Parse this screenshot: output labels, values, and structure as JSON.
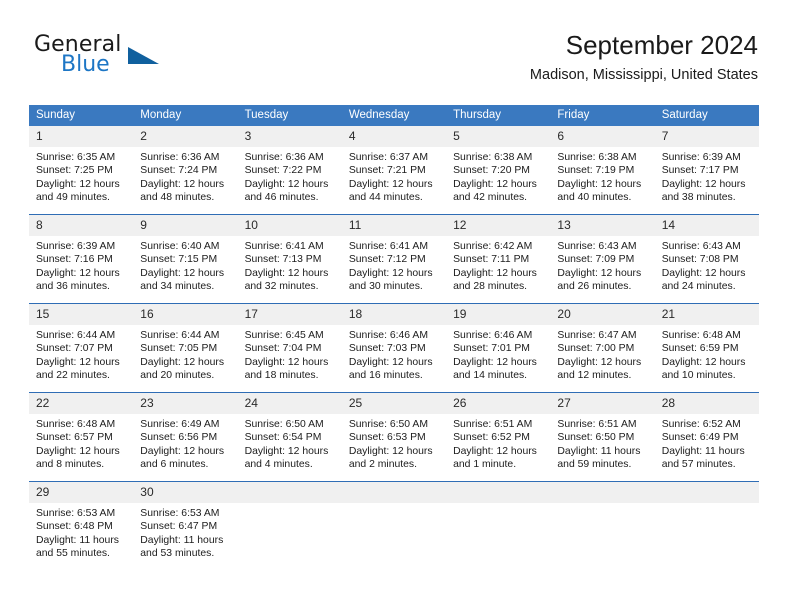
{
  "brand": {
    "name_top": "General",
    "name_bottom": "Blue",
    "accent_color": "#1d76c5",
    "triangle_color": "#10609e"
  },
  "header": {
    "title": "September 2024",
    "subtitle": "Madison, Mississippi, United States"
  },
  "theme": {
    "header_row_bg": "#3a79c0",
    "day_number_bg": "#f0f0f0",
    "row_separator": "#2f6db5"
  },
  "weekday_headers": [
    "Sunday",
    "Monday",
    "Tuesday",
    "Wednesday",
    "Thursday",
    "Friday",
    "Saturday"
  ],
  "labels": {
    "sunrise_prefix": "Sunrise:",
    "sunset_prefix": "Sunset:",
    "daylight_prefix": "Daylight:"
  },
  "weeks": [
    [
      {
        "day": "1",
        "sunrise": "Sunrise: 6:35 AM",
        "sunset": "Sunset: 7:25 PM",
        "daylight_line1": "Daylight: 12 hours",
        "daylight_line2": "and 49 minutes."
      },
      {
        "day": "2",
        "sunrise": "Sunrise: 6:36 AM",
        "sunset": "Sunset: 7:24 PM",
        "daylight_line1": "Daylight: 12 hours",
        "daylight_line2": "and 48 minutes."
      },
      {
        "day": "3",
        "sunrise": "Sunrise: 6:36 AM",
        "sunset": "Sunset: 7:22 PM",
        "daylight_line1": "Daylight: 12 hours",
        "daylight_line2": "and 46 minutes."
      },
      {
        "day": "4",
        "sunrise": "Sunrise: 6:37 AM",
        "sunset": "Sunset: 7:21 PM",
        "daylight_line1": "Daylight: 12 hours",
        "daylight_line2": "and 44 minutes."
      },
      {
        "day": "5",
        "sunrise": "Sunrise: 6:38 AM",
        "sunset": "Sunset: 7:20 PM",
        "daylight_line1": "Daylight: 12 hours",
        "daylight_line2": "and 42 minutes."
      },
      {
        "day": "6",
        "sunrise": "Sunrise: 6:38 AM",
        "sunset": "Sunset: 7:19 PM",
        "daylight_line1": "Daylight: 12 hours",
        "daylight_line2": "and 40 minutes."
      },
      {
        "day": "7",
        "sunrise": "Sunrise: 6:39 AM",
        "sunset": "Sunset: 7:17 PM",
        "daylight_line1": "Daylight: 12 hours",
        "daylight_line2": "and 38 minutes."
      }
    ],
    [
      {
        "day": "8",
        "sunrise": "Sunrise: 6:39 AM",
        "sunset": "Sunset: 7:16 PM",
        "daylight_line1": "Daylight: 12 hours",
        "daylight_line2": "and 36 minutes."
      },
      {
        "day": "9",
        "sunrise": "Sunrise: 6:40 AM",
        "sunset": "Sunset: 7:15 PM",
        "daylight_line1": "Daylight: 12 hours",
        "daylight_line2": "and 34 minutes."
      },
      {
        "day": "10",
        "sunrise": "Sunrise: 6:41 AM",
        "sunset": "Sunset: 7:13 PM",
        "daylight_line1": "Daylight: 12 hours",
        "daylight_line2": "and 32 minutes."
      },
      {
        "day": "11",
        "sunrise": "Sunrise: 6:41 AM",
        "sunset": "Sunset: 7:12 PM",
        "daylight_line1": "Daylight: 12 hours",
        "daylight_line2": "and 30 minutes."
      },
      {
        "day": "12",
        "sunrise": "Sunrise: 6:42 AM",
        "sunset": "Sunset: 7:11 PM",
        "daylight_line1": "Daylight: 12 hours",
        "daylight_line2": "and 28 minutes."
      },
      {
        "day": "13",
        "sunrise": "Sunrise: 6:43 AM",
        "sunset": "Sunset: 7:09 PM",
        "daylight_line1": "Daylight: 12 hours",
        "daylight_line2": "and 26 minutes."
      },
      {
        "day": "14",
        "sunrise": "Sunrise: 6:43 AM",
        "sunset": "Sunset: 7:08 PM",
        "daylight_line1": "Daylight: 12 hours",
        "daylight_line2": "and 24 minutes."
      }
    ],
    [
      {
        "day": "15",
        "sunrise": "Sunrise: 6:44 AM",
        "sunset": "Sunset: 7:07 PM",
        "daylight_line1": "Daylight: 12 hours",
        "daylight_line2": "and 22 minutes."
      },
      {
        "day": "16",
        "sunrise": "Sunrise: 6:44 AM",
        "sunset": "Sunset: 7:05 PM",
        "daylight_line1": "Daylight: 12 hours",
        "daylight_line2": "and 20 minutes."
      },
      {
        "day": "17",
        "sunrise": "Sunrise: 6:45 AM",
        "sunset": "Sunset: 7:04 PM",
        "daylight_line1": "Daylight: 12 hours",
        "daylight_line2": "and 18 minutes."
      },
      {
        "day": "18",
        "sunrise": "Sunrise: 6:46 AM",
        "sunset": "Sunset: 7:03 PM",
        "daylight_line1": "Daylight: 12 hours",
        "daylight_line2": "and 16 minutes."
      },
      {
        "day": "19",
        "sunrise": "Sunrise: 6:46 AM",
        "sunset": "Sunset: 7:01 PM",
        "daylight_line1": "Daylight: 12 hours",
        "daylight_line2": "and 14 minutes."
      },
      {
        "day": "20",
        "sunrise": "Sunrise: 6:47 AM",
        "sunset": "Sunset: 7:00 PM",
        "daylight_line1": "Daylight: 12 hours",
        "daylight_line2": "and 12 minutes."
      },
      {
        "day": "21",
        "sunrise": "Sunrise: 6:48 AM",
        "sunset": "Sunset: 6:59 PM",
        "daylight_line1": "Daylight: 12 hours",
        "daylight_line2": "and 10 minutes."
      }
    ],
    [
      {
        "day": "22",
        "sunrise": "Sunrise: 6:48 AM",
        "sunset": "Sunset: 6:57 PM",
        "daylight_line1": "Daylight: 12 hours",
        "daylight_line2": "and 8 minutes."
      },
      {
        "day": "23",
        "sunrise": "Sunrise: 6:49 AM",
        "sunset": "Sunset: 6:56 PM",
        "daylight_line1": "Daylight: 12 hours",
        "daylight_line2": "and 6 minutes."
      },
      {
        "day": "24",
        "sunrise": "Sunrise: 6:50 AM",
        "sunset": "Sunset: 6:54 PM",
        "daylight_line1": "Daylight: 12 hours",
        "daylight_line2": "and 4 minutes."
      },
      {
        "day": "25",
        "sunrise": "Sunrise: 6:50 AM",
        "sunset": "Sunset: 6:53 PM",
        "daylight_line1": "Daylight: 12 hours",
        "daylight_line2": "and 2 minutes."
      },
      {
        "day": "26",
        "sunrise": "Sunrise: 6:51 AM",
        "sunset": "Sunset: 6:52 PM",
        "daylight_line1": "Daylight: 12 hours",
        "daylight_line2": "and 1 minute."
      },
      {
        "day": "27",
        "sunrise": "Sunrise: 6:51 AM",
        "sunset": "Sunset: 6:50 PM",
        "daylight_line1": "Daylight: 11 hours",
        "daylight_line2": "and 59 minutes."
      },
      {
        "day": "28",
        "sunrise": "Sunrise: 6:52 AM",
        "sunset": "Sunset: 6:49 PM",
        "daylight_line1": "Daylight: 11 hours",
        "daylight_line2": "and 57 minutes."
      }
    ],
    [
      {
        "day": "29",
        "sunrise": "Sunrise: 6:53 AM",
        "sunset": "Sunset: 6:48 PM",
        "daylight_line1": "Daylight: 11 hours",
        "daylight_line2": "and 55 minutes."
      },
      {
        "day": "30",
        "sunrise": "Sunrise: 6:53 AM",
        "sunset": "Sunset: 6:47 PM",
        "daylight_line1": "Daylight: 11 hours",
        "daylight_line2": "and 53 minutes."
      },
      {
        "day": "",
        "sunrise": "",
        "sunset": "",
        "daylight_line1": "",
        "daylight_line2": ""
      },
      {
        "day": "",
        "sunrise": "",
        "sunset": "",
        "daylight_line1": "",
        "daylight_line2": ""
      },
      {
        "day": "",
        "sunrise": "",
        "sunset": "",
        "daylight_line1": "",
        "daylight_line2": ""
      },
      {
        "day": "",
        "sunrise": "",
        "sunset": "",
        "daylight_line1": "",
        "daylight_line2": ""
      },
      {
        "day": "",
        "sunrise": "",
        "sunset": "",
        "daylight_line1": "",
        "daylight_line2": ""
      }
    ]
  ]
}
